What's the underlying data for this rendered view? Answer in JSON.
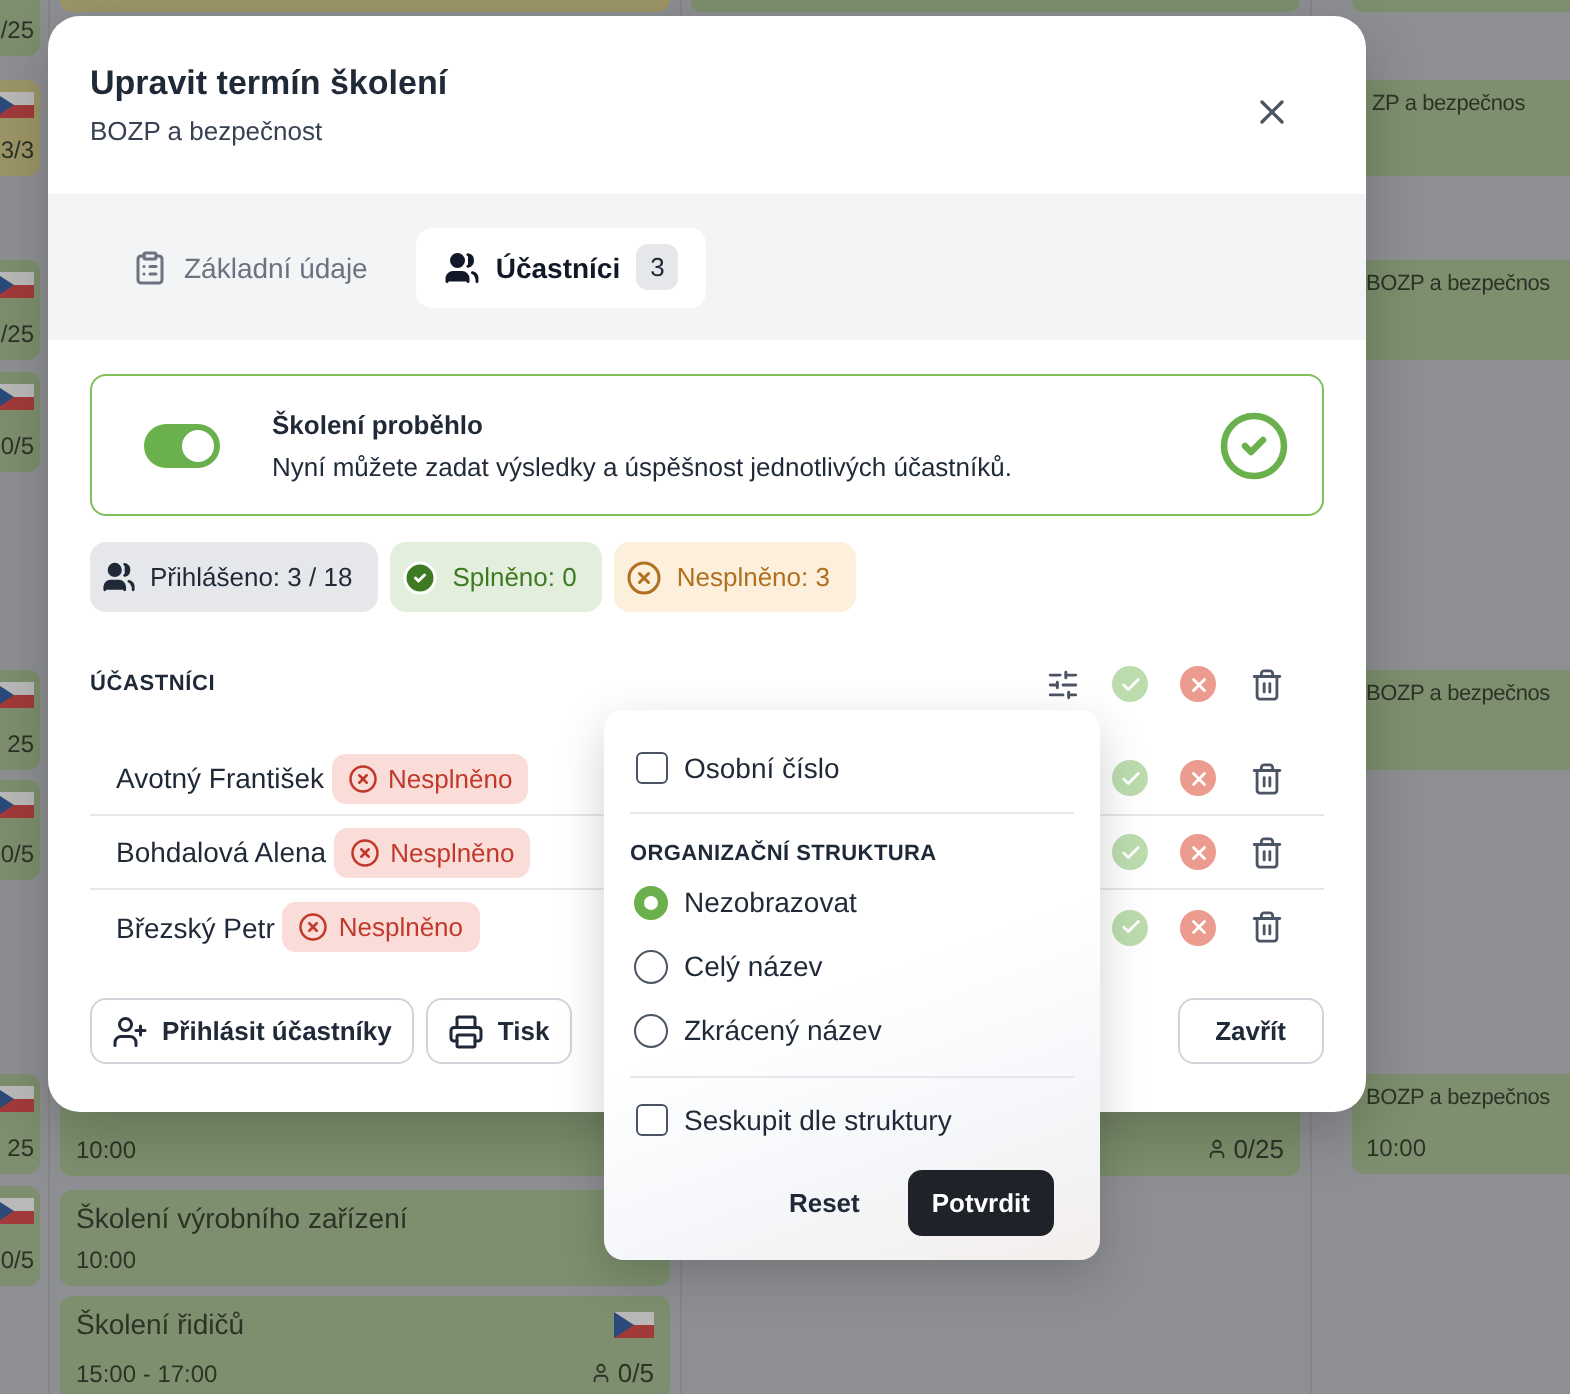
{
  "calendar": {
    "events": [
      {
        "count": "/25",
        "color": "#7d8f6e"
      },
      {
        "count": "3/3",
        "flag": true,
        "color": "#9c9566"
      },
      {
        "count": "/25",
        "flag": true,
        "color": "#7d8f6e"
      },
      {
        "count": "0/5",
        "flag": true,
        "color": "#7d8f6e"
      },
      {
        "count": "25",
        "flag": true,
        "color": "#7d8f6e"
      },
      {
        "count": "0/5",
        "flag": true,
        "color": "#7d8f6e"
      },
      {
        "count": "25",
        "flag": true,
        "color": "#7d8f6e"
      },
      {
        "count": "0/5",
        "flag": true,
        "color": "#7d8f6e"
      },
      {
        "color": "#9c9566"
      },
      {
        "time": "10:00",
        "color": "#7d8f6e"
      },
      {
        "title": "Školení výrobního zařízení",
        "time": "10:00",
        "color": "#7d8f6e"
      },
      {
        "title": "Školení řidičů",
        "time": "15:00 - 17:00",
        "count": "0/5",
        "flag": true,
        "color": "#7d8f6e"
      },
      {
        "color": "#7d8f6e"
      },
      {
        "count": "0/25",
        "color": "#7d8f6e"
      },
      {
        "color": "#7d8f6e"
      },
      {
        "title": "ZP a bezpečnos",
        "color": "#7d8f6e"
      },
      {
        "title": "BOZP a bezpečnos",
        "color": "#7d8f6e"
      },
      {
        "title": "BOZP a bezpečnos",
        "color": "#7d8f6e"
      },
      {
        "title": "BOZP a bezpečnos",
        "time": "10:00",
        "color": "#7d8f6e"
      }
    ]
  },
  "modal": {
    "title": "Upravit termín školení",
    "subtitle": "BOZP a bezpečnost",
    "tabs": [
      {
        "label": "Základní údaje",
        "selected": false
      },
      {
        "label": "Účastníci",
        "count": "3",
        "selected": true
      }
    ],
    "status": {
      "title": "Školení proběhlo",
      "text": "Nyní můžete zadat výsledky a úspěšnost jednotlivých účastníků.",
      "on": true
    },
    "stats": [
      {
        "kind": "registered",
        "label": "Přihlášeno: 3 / 18"
      },
      {
        "kind": "passed",
        "label": "Splněno: 0"
      },
      {
        "kind": "failed",
        "label": "Nesplněno: 3"
      }
    ],
    "participants": {
      "heading": "ÚČASTNÍCI",
      "rows": [
        {
          "name": "Avotný František",
          "result": "Nesplněno"
        },
        {
          "name": "Bohdalová Alena",
          "result": "Nesplněno"
        },
        {
          "name": "Březský Petr",
          "result": "Nesplněno"
        }
      ]
    },
    "buttons": [
      {
        "kind": "add",
        "label": "Přihlásit účastníky"
      },
      {
        "kind": "print",
        "label": "Tisk"
      }
    ],
    "close": "Zavřít"
  },
  "popover": {
    "personal": {
      "label": "Osobní číslo",
      "checked": false
    },
    "section": {
      "heading": "ORGANIZAČNÍ STRUKTURA",
      "options": [
        {
          "label": "Nezobrazovat",
          "selected": true
        },
        {
          "label": "Celý název",
          "selected": false
        },
        {
          "label": "Zkrácený název",
          "selected": false
        }
      ]
    },
    "group": {
      "label": "Seskupit dle struktury",
      "checked": false
    },
    "reset": "Reset",
    "confirm": "Potvrdit"
  }
}
